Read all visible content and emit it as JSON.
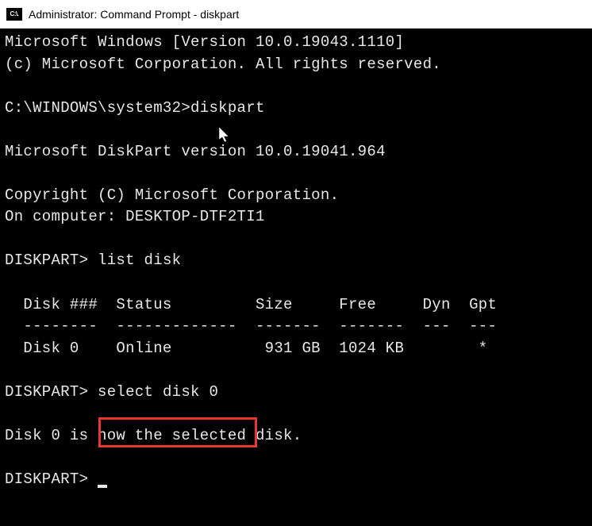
{
  "window": {
    "title": "Administrator: Command Prompt - diskpart",
    "icon_text": "C:\\."
  },
  "terminal": {
    "line1": "Microsoft Windows [Version 10.0.19043.1110]",
    "line2": "(c) Microsoft Corporation. All rights reserved.",
    "prompt1_path": "C:\\WINDOWS\\system32>",
    "prompt1_cmd": "diskpart",
    "diskpart_version": "Microsoft DiskPart version 10.0.19041.964",
    "copyright": "Copyright (C) Microsoft Corporation.",
    "computer": "On computer: DESKTOP-DTF2TI1",
    "prompt2": "DISKPART> ",
    "prompt2_cmd": "list disk",
    "table_header": "  Disk ###  Status         Size     Free     Dyn  Gpt",
    "table_divider": "  --------  -------------  -------  -------  ---  ---",
    "table_row1": "  Disk 0    Online          931 GB  1024 KB        *",
    "prompt3": "DISKPART> ",
    "prompt3_cmd": "select disk 0",
    "selected_msg": "Disk 0 is now the selected disk.",
    "prompt4": "DISKPART> "
  }
}
